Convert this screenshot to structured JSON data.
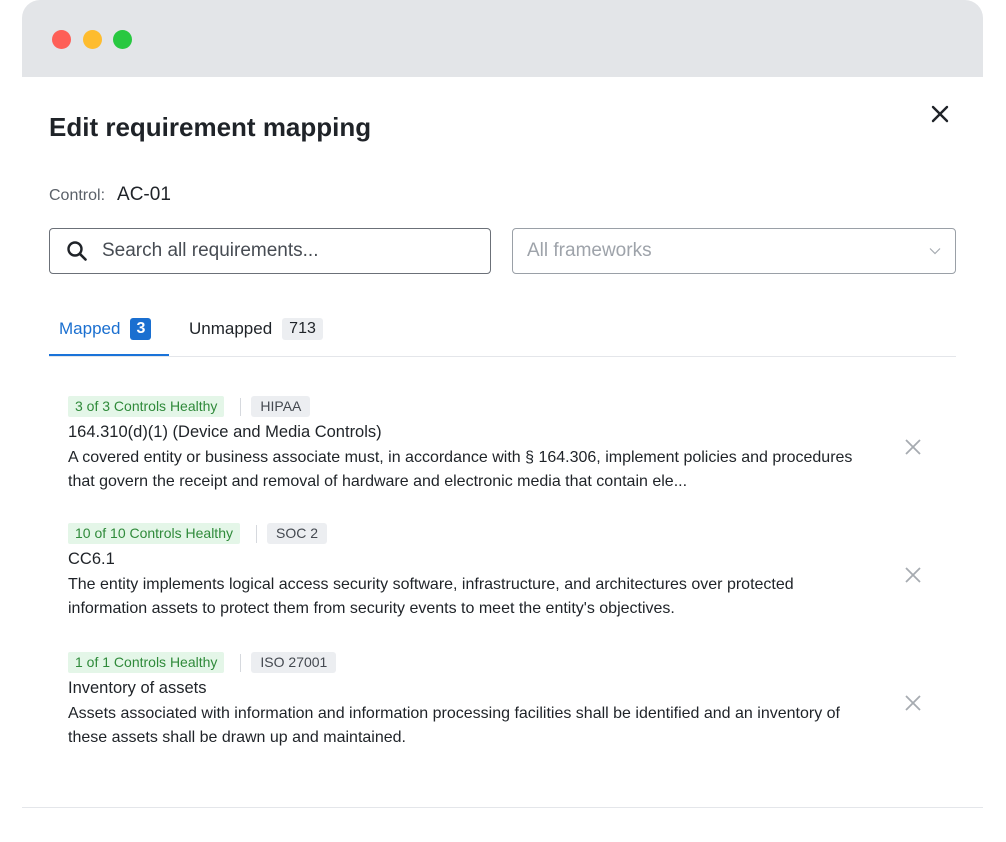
{
  "modal": {
    "title": "Edit requirement mapping",
    "close_icon": "close-icon"
  },
  "control": {
    "label": "Control:",
    "value": "AC-01"
  },
  "search": {
    "placeholder": "Search all requirements...",
    "value": "",
    "icon": "search-icon"
  },
  "framework_filter": {
    "placeholder": "All frameworks",
    "icon": "chevron-down-icon"
  },
  "tabs": [
    {
      "label": "Mapped",
      "count": "3",
      "active": true
    },
    {
      "label": "Unmapped",
      "count": "713",
      "active": false
    }
  ],
  "requirements": [
    {
      "health": "3 of 3 Controls Healthy",
      "framework": "HIPAA",
      "title": "164.310(d)(1) (Device and Media Controls)",
      "description": "A covered entity or business associate must, in accordance with § 164.306, implement policies and procedures that govern the receipt and removal of hardware and electronic media that contain ele..."
    },
    {
      "health": "10 of 10 Controls Healthy",
      "framework": "SOC 2",
      "title": "CC6.1",
      "description": "The entity implements logical access security software, infrastructure, and architectures over protected information assets to protect them from security events to meet the entity's objectives."
    },
    {
      "health": "1 of 1 Controls Healthy",
      "framework": "ISO 27001",
      "title": "Inventory of assets",
      "description": "Assets associated with information and information processing facilities shall be identified and an inventory of these assets shall be drawn up and maintained."
    }
  ],
  "colors": {
    "accent": "#1a6fd0",
    "healthy_bg": "#e4f6e8",
    "healthy_text": "#2f8a3a",
    "window_red": "#fe5f57",
    "window_yellow": "#febc2e",
    "window_green": "#28c840"
  }
}
